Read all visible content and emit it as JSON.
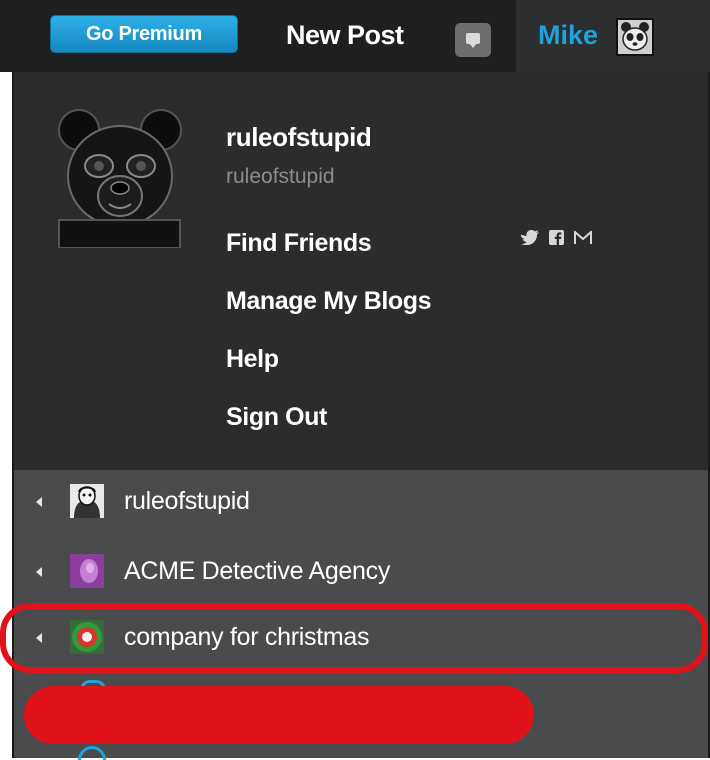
{
  "topbar": {
    "premium_label": "Go Premium",
    "new_post_label": "New Post",
    "user_name": "Mike"
  },
  "profile": {
    "blog_name": "ruleofstupid",
    "blog_sub": "ruleofstupid",
    "menu": [
      {
        "label": "Find Friends"
      },
      {
        "label": "Manage My Blogs"
      },
      {
        "label": "Help"
      },
      {
        "label": "Sign Out"
      }
    ],
    "social_icons": [
      "twitter-icon",
      "facebook-icon",
      "gmail-icon"
    ]
  },
  "blogs": [
    {
      "label": "ruleofstupid",
      "icon": "portrait-avatar"
    },
    {
      "label": "ACME Detective Agency",
      "icon": "purple-avatar"
    },
    {
      "label": "company for christmas",
      "icon": "c4c-avatar"
    }
  ],
  "colors": {
    "accent_blue": "#1ea3dc",
    "highlight_red": "#e0121a",
    "topbar_bg": "#1e1f20",
    "dropdown_bg": "#2b2c2d",
    "blogs_bg": "#4a4b4c"
  }
}
